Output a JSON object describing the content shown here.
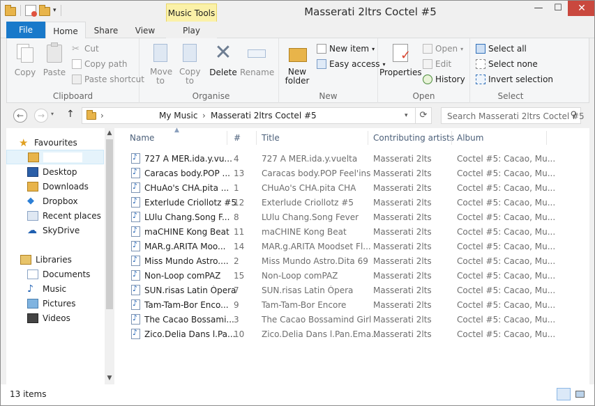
{
  "window": {
    "title": "Masserati 2ltrs Coctel #5",
    "context_tab": "Music Tools",
    "min": "—",
    "max": "☐",
    "close": "✕"
  },
  "tabs": {
    "file": "File",
    "home": "Home",
    "share": "Share",
    "view": "View",
    "play": "Play",
    "collapse": "^",
    "help": "?"
  },
  "ribbon": {
    "clipboard": {
      "label": "Clipboard",
      "copy": "Copy",
      "paste": "Paste",
      "cut": "Cut",
      "copy_path": "Copy path",
      "paste_shortcut": "Paste shortcut"
    },
    "organise": {
      "label": "Organise",
      "move_to": "Move to",
      "copy_to": "Copy to",
      "delete": "Delete",
      "rename": "Rename"
    },
    "new": {
      "label": "New",
      "new_folder": "New folder",
      "new_item": "New item",
      "easy_access": "Easy access"
    },
    "open": {
      "label": "Open",
      "properties": "Properties",
      "open": "Open",
      "edit": "Edit",
      "history": "History"
    },
    "select": {
      "label": "Select",
      "select_all": "Select all",
      "select_none": "Select none",
      "invert_selection": "Invert selection"
    }
  },
  "nav": {
    "back": "←",
    "forward": "→",
    "up": "↑",
    "breadcrumb1": "My Music",
    "breadcrumb2": "Masserati 2ltrs Coctel #5",
    "refresh": "⟳",
    "search_placeholder": "Search Masserati 2ltrs Coctel #5",
    "search_icon": "⚲"
  },
  "sidebar": {
    "favourites": "Favourites",
    "desktop": "Desktop",
    "downloads": "Downloads",
    "dropbox": "Dropbox",
    "recent": "Recent places",
    "skydrive": "SkyDrive",
    "libraries": "Libraries",
    "documents": "Documents",
    "music": "Music",
    "pictures": "Pictures",
    "videos": "Videos"
  },
  "columns": {
    "name": "Name",
    "num": "#",
    "title": "Title",
    "artists": "Contributing artists",
    "album": "Album"
  },
  "files": [
    {
      "name": "727 A MER.ida.y.vu...",
      "num": "4",
      "title": "727 A MER.ida.y.vuelta",
      "artist": "Masserati 2lts",
      "album": "Coctel #5: Cacao, Mu..."
    },
    {
      "name": "Caracas body.POP ...",
      "num": "13",
      "title": "Caracas body.POP Feel'ins",
      "artist": "Masserati 2lts",
      "album": "Coctel #5: Cacao, Mu..."
    },
    {
      "name": "CHuAo's CHA.pita ...",
      "num": "1",
      "title": "CHuAo's CHA.pita CHA",
      "artist": "Masserati 2lts",
      "album": "Coctel #5: Cacao, Mu..."
    },
    {
      "name": "Exterlude Criollotz #5",
      "num": "12",
      "title": "Exterlude Criollotz #5",
      "artist": "Masserati 2lts",
      "album": "Coctel #5: Cacao, Mu..."
    },
    {
      "name": "LUlu Chang.Song F...",
      "num": "8",
      "title": "LUlu Chang.Song Fever",
      "artist": "Masserati 2lts",
      "album": "Coctel #5: Cacao, Mu..."
    },
    {
      "name": "maCHINE Kong Beat",
      "num": "11",
      "title": "maCHINE Kong Beat",
      "artist": "Masserati 2lts",
      "album": "Coctel #5: Cacao, Mu..."
    },
    {
      "name": "MAR.g.ARITA Moo...",
      "num": "14",
      "title": "MAR.g.ARITA Moodset Fl...",
      "artist": "Masserati 2lts",
      "album": "Coctel #5: Cacao, Mu..."
    },
    {
      "name": "Miss Mundo Astro....",
      "num": "2",
      "title": "Miss Mundo Astro.Dita 69",
      "artist": "Masserati 2lts",
      "album": "Coctel #5: Cacao, Mu..."
    },
    {
      "name": "Non-Loop comPAZ",
      "num": "15",
      "title": "Non-Loop comPAZ",
      "artist": "Masserati 2lts",
      "album": "Coctel #5: Cacao, Mu..."
    },
    {
      "name": "SUN.risas Latin Ópera",
      "num": "7",
      "title": "SUN.risas Latin Ópera",
      "artist": "Masserati 2lts",
      "album": "Coctel #5: Cacao, Mu..."
    },
    {
      "name": "Tam-Tam-Bor Enco...",
      "num": "9",
      "title": "Tam-Tam-Bor Encore",
      "artist": "Masserati 2lts",
      "album": "Coctel #5: Cacao, Mu..."
    },
    {
      "name": "The Cacao Bossami...",
      "num": "3",
      "title": "The Cacao Bossamind Girl",
      "artist": "Masserati 2lts",
      "album": "Coctel #5: Cacao, Mu..."
    },
    {
      "name": "Zico.Delia Dans l.Pa...",
      "num": "10",
      "title": "Zico.Delia Dans l.Pan.Ema...",
      "artist": "Masserati 2lts",
      "album": "Coctel #5: Cacao, Mu..."
    }
  ],
  "status": {
    "count": "13 items"
  },
  "colors": {
    "accent": "#1979ca",
    "close": "#c9483e",
    "context_tab": "#fbf1a8"
  }
}
